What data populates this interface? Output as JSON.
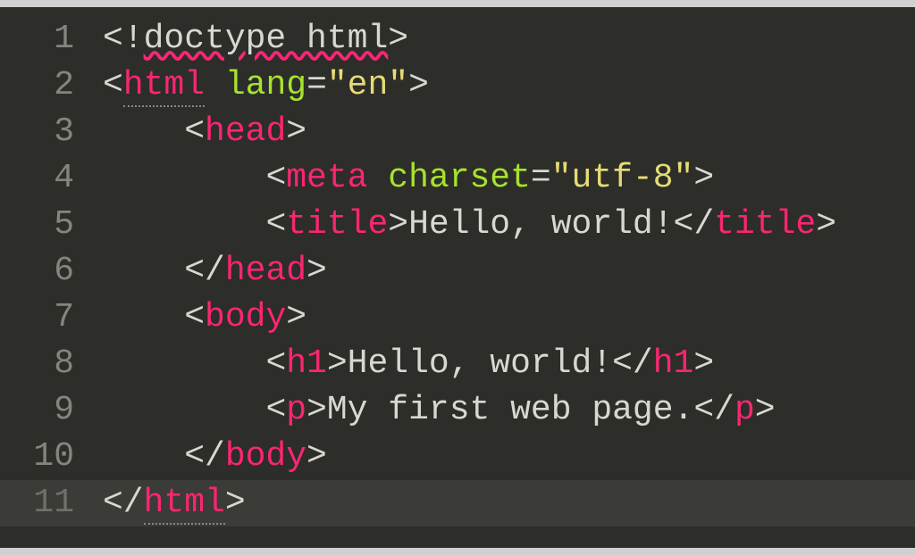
{
  "editor": {
    "active_line": 11,
    "lines": [
      {
        "num": 1,
        "indent": 0,
        "segments": [
          {
            "type": "bracket",
            "text": "<!"
          },
          {
            "type": "doctype",
            "text": "doctype html",
            "squiggly": true
          },
          {
            "type": "bracket",
            "text": ">"
          }
        ]
      },
      {
        "num": 2,
        "indent": 0,
        "segments": [
          {
            "type": "bracket",
            "text": "<"
          },
          {
            "type": "tag-name",
            "text": "html",
            "dotted": true
          },
          {
            "type": "text-content",
            "text": " "
          },
          {
            "type": "attr-name",
            "text": "lang"
          },
          {
            "type": "bracket",
            "text": "="
          },
          {
            "type": "attr-value",
            "text": "\"en\""
          },
          {
            "type": "bracket",
            "text": ">"
          }
        ]
      },
      {
        "num": 3,
        "indent": 1,
        "segments": [
          {
            "type": "bracket",
            "text": "<"
          },
          {
            "type": "tag-name",
            "text": "head"
          },
          {
            "type": "bracket",
            "text": ">"
          }
        ]
      },
      {
        "num": 4,
        "indent": 2,
        "segments": [
          {
            "type": "bracket",
            "text": "<"
          },
          {
            "type": "tag-name",
            "text": "meta"
          },
          {
            "type": "text-content",
            "text": " "
          },
          {
            "type": "attr-name",
            "text": "charset"
          },
          {
            "type": "bracket",
            "text": "="
          },
          {
            "type": "attr-value",
            "text": "\"utf-8\""
          },
          {
            "type": "bracket",
            "text": ">"
          }
        ]
      },
      {
        "num": 5,
        "indent": 2,
        "segments": [
          {
            "type": "bracket",
            "text": "<"
          },
          {
            "type": "tag-name",
            "text": "title"
          },
          {
            "type": "bracket",
            "text": ">"
          },
          {
            "type": "text-content",
            "text": "Hello, world!"
          },
          {
            "type": "bracket",
            "text": "</"
          },
          {
            "type": "tag-name",
            "text": "title"
          },
          {
            "type": "bracket",
            "text": ">"
          }
        ]
      },
      {
        "num": 6,
        "indent": 1,
        "segments": [
          {
            "type": "bracket",
            "text": "</"
          },
          {
            "type": "tag-name",
            "text": "head"
          },
          {
            "type": "bracket",
            "text": ">"
          }
        ]
      },
      {
        "num": 7,
        "indent": 1,
        "segments": [
          {
            "type": "bracket",
            "text": "<"
          },
          {
            "type": "tag-name",
            "text": "body"
          },
          {
            "type": "bracket",
            "text": ">"
          }
        ]
      },
      {
        "num": 8,
        "indent": 2,
        "segments": [
          {
            "type": "bracket",
            "text": "<"
          },
          {
            "type": "tag-name",
            "text": "h1"
          },
          {
            "type": "bracket",
            "text": ">"
          },
          {
            "type": "text-content",
            "text": "Hello, world!"
          },
          {
            "type": "bracket",
            "text": "</"
          },
          {
            "type": "tag-name",
            "text": "h1"
          },
          {
            "type": "bracket",
            "text": ">"
          }
        ]
      },
      {
        "num": 9,
        "indent": 2,
        "segments": [
          {
            "type": "bracket",
            "text": "<"
          },
          {
            "type": "tag-name",
            "text": "p"
          },
          {
            "type": "bracket",
            "text": ">"
          },
          {
            "type": "text-content",
            "text": "My first web page."
          },
          {
            "type": "bracket",
            "text": "</"
          },
          {
            "type": "tag-name",
            "text": "p"
          },
          {
            "type": "bracket",
            "text": ">"
          }
        ]
      },
      {
        "num": 10,
        "indent": 1,
        "segments": [
          {
            "type": "bracket",
            "text": "</"
          },
          {
            "type": "tag-name",
            "text": "body"
          },
          {
            "type": "bracket",
            "text": ">"
          }
        ]
      },
      {
        "num": 11,
        "indent": 0,
        "segments": [
          {
            "type": "bracket",
            "text": "</"
          },
          {
            "type": "tag-name",
            "text": "html",
            "dotted": true
          },
          {
            "type": "bracket",
            "text": ">"
          }
        ]
      }
    ]
  }
}
